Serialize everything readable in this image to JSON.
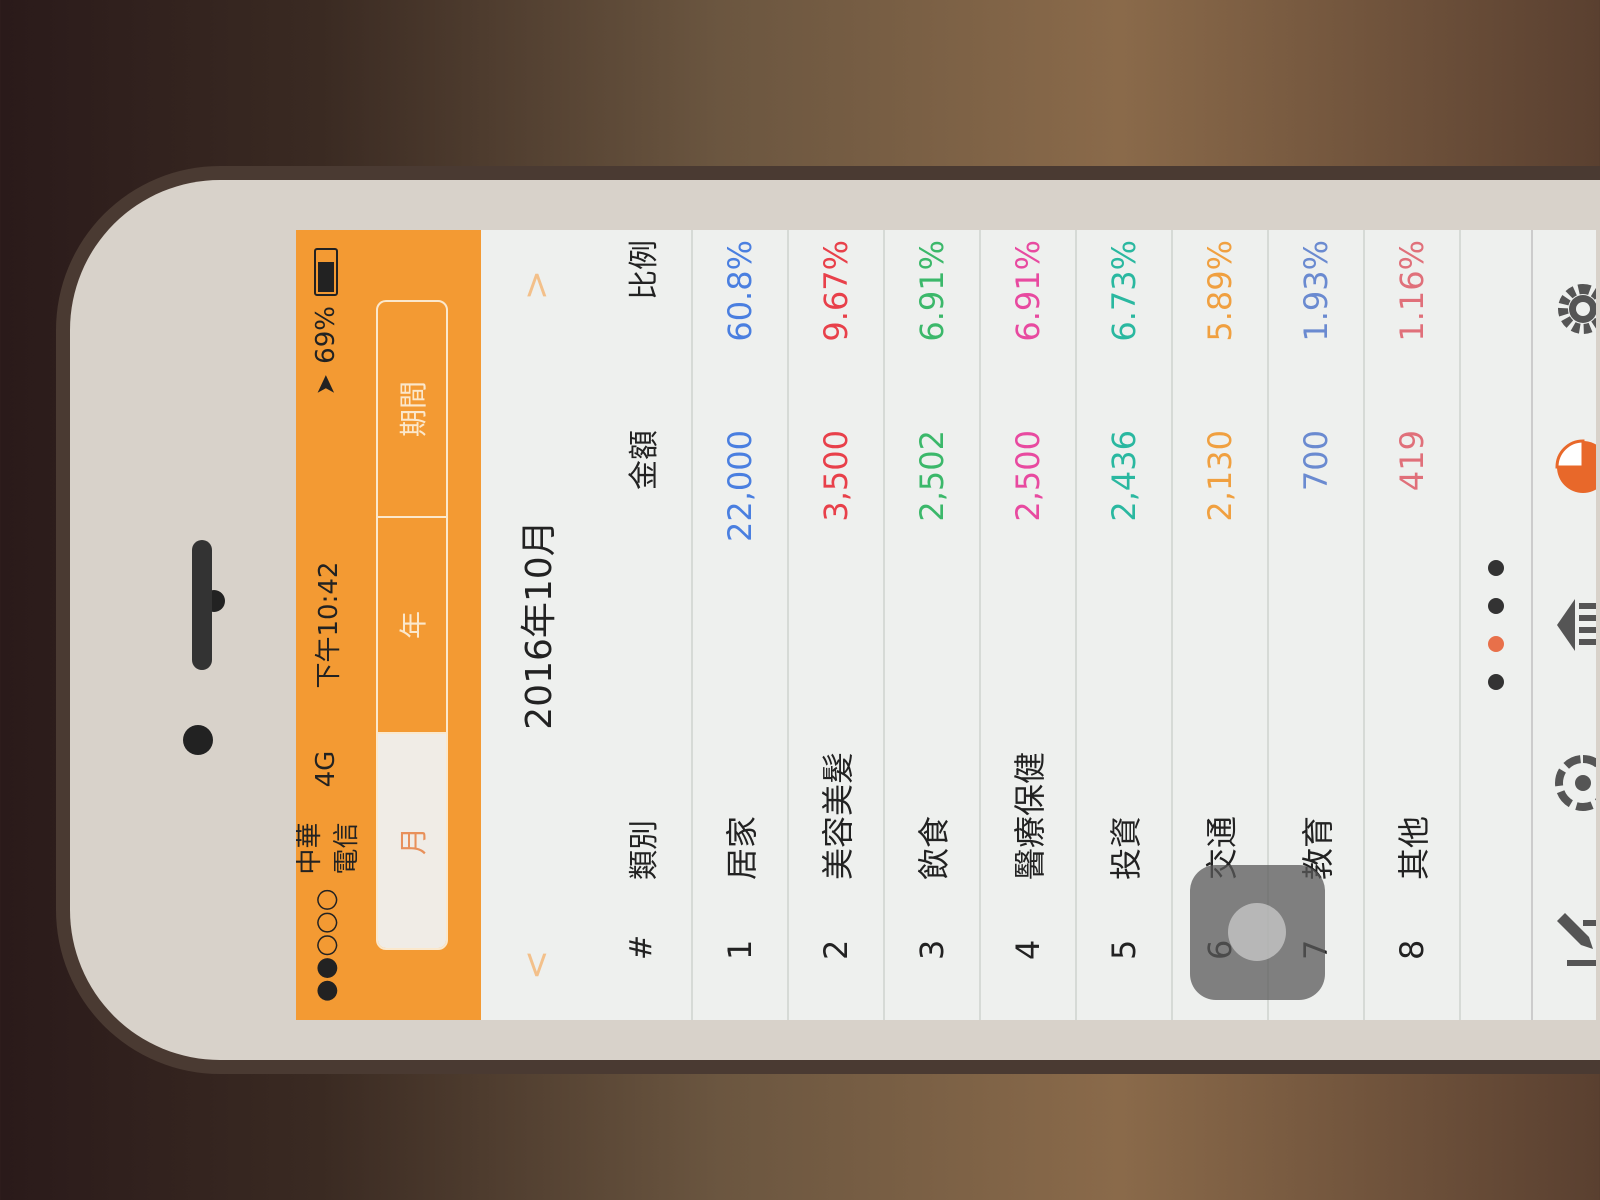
{
  "status_bar": {
    "signal": "●●○○○",
    "carrier": "中華電信",
    "network": "4G",
    "time": "下午10:42",
    "battery": "69%",
    "battery_level": 0.69
  },
  "segments": [
    {
      "label": "月",
      "active": true
    },
    {
      "label": "年",
      "active": false
    },
    {
      "label": "期間",
      "active": false
    }
  ],
  "date_nav": {
    "prev": "<",
    "title": "2016年10月",
    "next": ">"
  },
  "table": {
    "headers": [
      "#",
      "類別",
      "金額",
      "比例"
    ],
    "rows": [
      {
        "no": "1",
        "category": "居家",
        "amount": "22,000",
        "ratio": "60.8%",
        "color": "#4a7fe0"
      },
      {
        "no": "2",
        "category": "美容美髮",
        "amount": "3,500",
        "ratio": "9.67%",
        "color": "#e8404a"
      },
      {
        "no": "3",
        "category": "飲食",
        "amount": "2,502",
        "ratio": "6.91%",
        "color": "#3bb86a"
      },
      {
        "no": "4",
        "category": "醫療保健",
        "amount": "2,500",
        "ratio": "6.91%",
        "color": "#e84aa0"
      },
      {
        "no": "5",
        "category": "投資",
        "amount": "2,436",
        "ratio": "6.73%",
        "color": "#2ab8a0"
      },
      {
        "no": "6",
        "category": "交通",
        "amount": "2,130",
        "ratio": "5.89%",
        "color": "#f0a040"
      },
      {
        "no": "7",
        "category": "教育",
        "amount": "700",
        "ratio": "1.93%",
        "color": "#6a8ad0"
      },
      {
        "no": "8",
        "category": "其他",
        "amount": "419",
        "ratio": "1.16%",
        "color": "#e0707a"
      }
    ]
  },
  "page_dots": {
    "count": 4,
    "active_index": 1
  },
  "tabbar": [
    "edit-icon",
    "camera-shutter-icon",
    "bank-icon",
    "pie-chart-icon",
    "gear-icon"
  ],
  "accent": "#f39a33"
}
